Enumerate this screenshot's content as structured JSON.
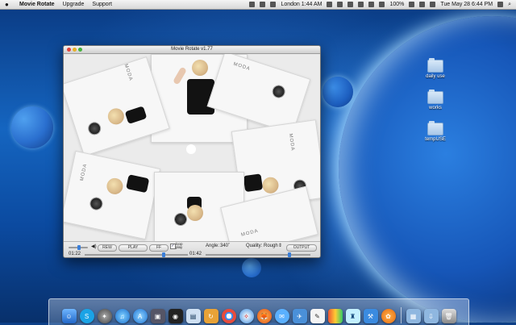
{
  "menubar": {
    "app_name": "Movie Rotate",
    "items": [
      "Upgrade",
      "Support"
    ],
    "clock_city": "London 1:44 AM",
    "battery": "100%",
    "datetime": "Tue May 28  6:44 PM"
  },
  "desktop_folders": [
    {
      "label": "daily use"
    },
    {
      "label": "works"
    },
    {
      "label": "tempUSE"
    }
  ],
  "window": {
    "title": "Movie Rotate v1.77",
    "stage_text": "MODA",
    "controls": {
      "rew_label": "REW",
      "play_label": "PLAY",
      "ff_label": "FF",
      "loop_label": "loop play",
      "loop_checked": true,
      "angle_label": "Angle:",
      "angle_value": "340˚",
      "quality_label": "Quality:",
      "quality_value": "Rough",
      "output_label": "OUTPUT",
      "time_current": "01:22",
      "time_total": "01:42",
      "volume_level": 0.55,
      "playback_progress": 0.8
    }
  },
  "dock": {
    "icons": [
      "finder-icon",
      "skype-icon",
      "launchpad-icon",
      "itunes-icon",
      "app-store-icon",
      "screenshot-icon",
      "photo-booth-icon",
      "preview-icon",
      "movie-rotate-icon",
      "chrome-icon",
      "safari-icon",
      "firefox-icon",
      "messages-icon",
      "mail-icon",
      "textedit-icon",
      "instruments-icon",
      "bottle-icon",
      "xcode-icon",
      "orange-app-icon",
      "applications-folder-icon",
      "downloads-folder-icon",
      "trash-icon"
    ]
  }
}
